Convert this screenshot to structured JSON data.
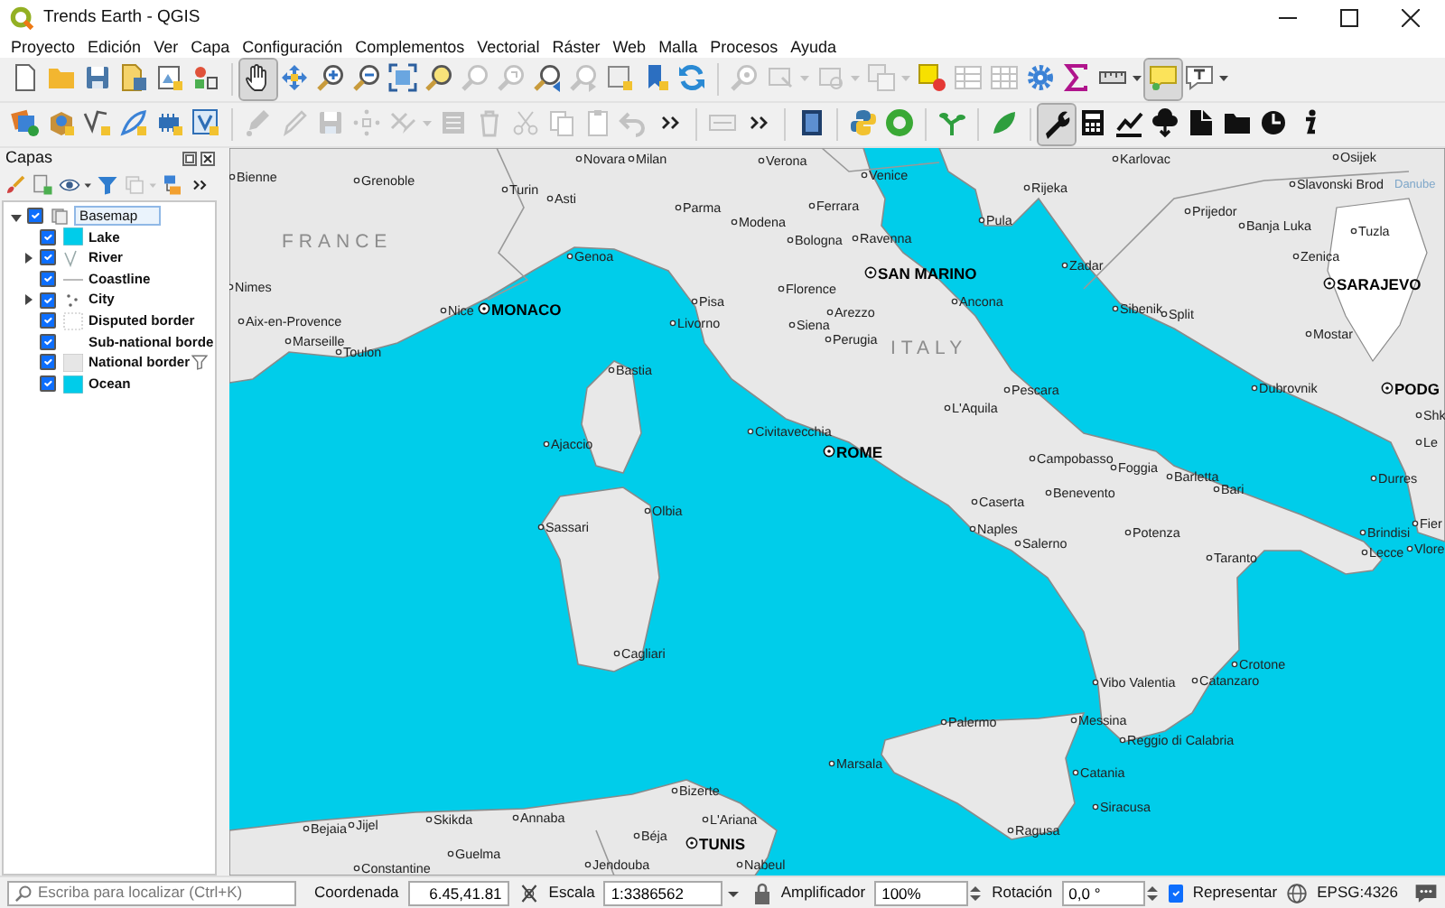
{
  "window": {
    "title": "Trends Earth - QGIS"
  },
  "menu": [
    "Proyecto",
    "Edición",
    "Ver",
    "Capa",
    "Configuración",
    "Complementos",
    "Vectorial",
    "Ráster",
    "Web",
    "Malla",
    "Procesos",
    "Ayuda"
  ],
  "toolbars": [
    {
      "groups": [
        {
          "items": [
            {
              "kind": "new",
              "disabled": false,
              "selected": false
            },
            {
              "kind": "open",
              "disabled": false,
              "selected": false
            },
            {
              "kind": "save",
              "disabled": false,
              "selected": false
            },
            {
              "kind": "saveas",
              "disabled": false,
              "selected": false
            },
            {
              "kind": "layout",
              "disabled": false,
              "selected": false
            },
            {
              "kind": "style",
              "disabled": false,
              "selected": false
            }
          ]
        },
        {
          "items": [
            {
              "kind": "pan",
              "disabled": false,
              "selected": true
            },
            {
              "kind": "pansel",
              "disabled": false,
              "selected": false
            },
            {
              "kind": "zoomin",
              "disabled": false,
              "selected": false
            },
            {
              "kind": "zoomout",
              "disabled": false,
              "selected": false
            },
            {
              "kind": "zoomfull",
              "disabled": false,
              "selected": false
            },
            {
              "kind": "zoomsel",
              "disabled": false,
              "selected": false
            },
            {
              "kind": "zoomlayer",
              "disabled": true,
              "selected": false
            },
            {
              "kind": "zoomnative",
              "disabled": true,
              "selected": false
            },
            {
              "kind": "zoomlast",
              "disabled": false,
              "selected": false
            },
            {
              "kind": "zoomnext",
              "disabled": true,
              "selected": false
            },
            {
              "kind": "mapview",
              "disabled": false,
              "selected": false
            },
            {
              "kind": "bookmark",
              "disabled": false,
              "selected": false
            },
            {
              "kind": "refresh",
              "disabled": false,
              "selected": false
            }
          ]
        },
        {
          "items": [
            {
              "kind": "identify",
              "disabled": true,
              "selected": false
            },
            {
              "kind": "select",
              "disabled": true,
              "selected": false,
              "dropdown": true
            },
            {
              "kind": "selval",
              "disabled": true,
              "selected": false,
              "dropdown": true
            },
            {
              "kind": "deselect",
              "disabled": true,
              "selected": false,
              "dropdown": true
            },
            {
              "kind": "attrsel",
              "disabled": false,
              "selected": false
            },
            {
              "kind": "table",
              "disabled": true,
              "selected": false
            },
            {
              "kind": "fieldcalc",
              "disabled": true,
              "selected": false
            },
            {
              "kind": "gear",
              "disabled": false,
              "selected": false
            },
            {
              "kind": "sigma",
              "disabled": false,
              "selected": false
            },
            {
              "kind": "ruler",
              "disabled": false,
              "selected": false,
              "dropdown": true
            },
            {
              "kind": "annot",
              "disabled": false,
              "selected": true
            },
            {
              "kind": "text",
              "disabled": false,
              "selected": false,
              "dropdown": true
            }
          ]
        }
      ]
    },
    {
      "groups": [
        {
          "items": [
            {
              "kind": "datasrc",
              "disabled": false,
              "selected": false
            },
            {
              "kind": "package",
              "disabled": false,
              "selected": false
            },
            {
              "kind": "vertex",
              "disabled": false,
              "selected": false
            },
            {
              "kind": "feather",
              "disabled": false,
              "selected": false
            },
            {
              "kind": "chip",
              "disabled": false,
              "selected": false
            },
            {
              "kind": "virtual",
              "disabled": false,
              "selected": false
            }
          ]
        },
        {
          "items": [
            {
              "kind": "editpencil",
              "disabled": true,
              "selected": false
            },
            {
              "kind": "pencil",
              "disabled": true,
              "selected": false
            },
            {
              "kind": "save",
              "disabled": true,
              "selected": false
            },
            {
              "kind": "nodes",
              "disabled": true,
              "selected": false
            },
            {
              "kind": "delsel",
              "disabled": true,
              "selected": false,
              "dropdown": true
            },
            {
              "kind": "attrtable",
              "disabled": true,
              "selected": false
            },
            {
              "kind": "trash",
              "disabled": true,
              "selected": false
            },
            {
              "kind": "scissors",
              "disabled": true,
              "selected": false
            },
            {
              "kind": "copy",
              "disabled": true,
              "selected": false
            },
            {
              "kind": "paste",
              "disabled": true,
              "selected": false
            },
            {
              "kind": "undo",
              "disabled": true,
              "selected": false
            },
            {
              "kind": "more",
              "disabled": false,
              "selected": false
            }
          ]
        },
        {
          "items": [
            {
              "kind": "label",
              "disabled": true,
              "selected": false
            },
            {
              "kind": "more",
              "disabled": false,
              "selected": false
            }
          ]
        },
        {
          "items": [
            {
              "kind": "help",
              "disabled": false,
              "selected": false
            }
          ]
        },
        {
          "items": [
            {
              "kind": "python",
              "disabled": false,
              "selected": false
            },
            {
              "kind": "ring",
              "disabled": false,
              "selected": false
            }
          ]
        },
        {
          "items": [
            {
              "kind": "sprout",
              "disabled": false,
              "selected": false
            }
          ]
        },
        {
          "items": [
            {
              "kind": "leaf",
              "disabled": false,
              "selected": false
            }
          ]
        },
        {
          "items": [
            {
              "kind": "wrench",
              "disabled": false,
              "selected": true
            },
            {
              "kind": "calc",
              "disabled": false,
              "selected": false
            },
            {
              "kind": "chart",
              "disabled": false,
              "selected": false
            },
            {
              "kind": "cloud",
              "disabled": false,
              "selected": false
            },
            {
              "kind": "doc",
              "disabled": false,
              "selected": false
            },
            {
              "kind": "folderb",
              "disabled": false,
              "selected": false
            },
            {
              "kind": "clock",
              "disabled": false,
              "selected": false
            },
            {
              "kind": "info",
              "disabled": false,
              "selected": false
            }
          ]
        }
      ]
    }
  ],
  "layers_panel": {
    "title": "Capas",
    "toolbar": [
      {
        "kind": "brush",
        "disabled": false
      },
      {
        "kind": "addgroup",
        "disabled": false
      },
      {
        "kind": "eye",
        "disabled": false,
        "dropdown": true
      },
      {
        "kind": "filter",
        "disabled": false
      },
      {
        "kind": "filterexp",
        "disabled": true,
        "dropdown": true
      },
      {
        "kind": "expand",
        "disabled": false
      },
      {
        "kind": "more",
        "disabled": false
      }
    ],
    "tree": [
      {
        "name": "Basemap",
        "checked": true,
        "expanded": true,
        "selected": true,
        "children": [
          {
            "name": "Lake",
            "checked": true,
            "selected": false,
            "kind": "fill",
            "color": "#00ccea",
            "filtered": false
          },
          {
            "name": "River",
            "checked": true,
            "expanded": false,
            "selected": false,
            "kind": "river",
            "filtered": false
          },
          {
            "name": "Coastline",
            "checked": true,
            "selected": false,
            "kind": "line",
            "filtered": false
          },
          {
            "name": "City",
            "checked": true,
            "expanded": false,
            "selected": false,
            "kind": "points",
            "filtered": false
          },
          {
            "name": "Disputed border",
            "checked": true,
            "selected": false,
            "kind": "outline",
            "filtered": false
          },
          {
            "name": "Sub-national borde",
            "checked": true,
            "selected": false,
            "kind": "blank",
            "filtered": false
          },
          {
            "name": "National border",
            "checked": true,
            "selected": false,
            "kind": "fill",
            "color": "#e6e6e6",
            "filtered": true
          },
          {
            "name": "Ocean",
            "checked": true,
            "selected": false,
            "kind": "fill",
            "color": "#00ccea",
            "filtered": false
          }
        ]
      }
    ]
  },
  "map": {
    "places": [
      {
        "name": "Novara",
        "kind": "city"
      },
      {
        "name": "Milan",
        "kind": "city"
      },
      {
        "name": "Verona",
        "kind": "city"
      },
      {
        "name": "Karlovac",
        "kind": "city"
      },
      {
        "name": "Osijek",
        "kind": "city"
      },
      {
        "name": "Bienne",
        "kind": "city"
      },
      {
        "name": "Grenoble",
        "kind": "city"
      },
      {
        "name": "Venice",
        "kind": "city"
      },
      {
        "name": "Turin",
        "kind": "city"
      },
      {
        "name": "Rijeka",
        "kind": "city"
      },
      {
        "name": "Slavonski Brod",
        "kind": "city"
      },
      {
        "name": "Danube",
        "kind": "river"
      },
      {
        "name": "Asti",
        "kind": "city"
      },
      {
        "name": "Parma",
        "kind": "city"
      },
      {
        "name": "Ferrara",
        "kind": "city"
      },
      {
        "name": "Prijedor",
        "kind": "city"
      },
      {
        "name": "Modena",
        "kind": "city"
      },
      {
        "name": "Pula",
        "kind": "city"
      },
      {
        "name": "Banja Luka",
        "kind": "city"
      },
      {
        "name": "Tuzla",
        "kind": "city"
      },
      {
        "name": "FRANCE",
        "kind": "country"
      },
      {
        "name": "Bologna",
        "kind": "city"
      },
      {
        "name": "Ravenna",
        "kind": "city"
      },
      {
        "name": "Genoa",
        "kind": "city"
      },
      {
        "name": "Zenica",
        "kind": "city"
      },
      {
        "name": "SAN MARINO",
        "kind": "capital"
      },
      {
        "name": "Zadar",
        "kind": "city"
      },
      {
        "name": "Nimes",
        "kind": "city"
      },
      {
        "name": "Florence",
        "kind": "city"
      },
      {
        "name": "SARAJEVO",
        "kind": "capital"
      },
      {
        "name": "Pisa",
        "kind": "city"
      },
      {
        "name": "Ancona",
        "kind": "city"
      },
      {
        "name": "Nice",
        "kind": "city"
      },
      {
        "name": "MONACO",
        "kind": "capital"
      },
      {
        "name": "Arezzo",
        "kind": "city"
      },
      {
        "name": "Sibenik",
        "kind": "city"
      },
      {
        "name": "Split",
        "kind": "city"
      },
      {
        "name": "Aix-en-Provence",
        "kind": "city"
      },
      {
        "name": "Livorno",
        "kind": "city"
      },
      {
        "name": "Siena",
        "kind": "city"
      },
      {
        "name": "Marseille",
        "kind": "city"
      },
      {
        "name": "Perugia",
        "kind": "city"
      },
      {
        "name": "Mostar",
        "kind": "city"
      },
      {
        "name": "Toulon",
        "kind": "city"
      },
      {
        "name": "ITALY",
        "kind": "country"
      },
      {
        "name": "Bastia",
        "kind": "city"
      },
      {
        "name": "Pescara",
        "kind": "city"
      },
      {
        "name": "Dubrovnik",
        "kind": "city"
      },
      {
        "name": "PODG",
        "kind": "capital"
      },
      {
        "name": "L'Aquila",
        "kind": "city"
      },
      {
        "name": "Shk",
        "kind": "city"
      },
      {
        "name": "Civitavecchia",
        "kind": "city"
      },
      {
        "name": "Ajaccio",
        "kind": "city"
      },
      {
        "name": "ROME",
        "kind": "capital"
      },
      {
        "name": "Le",
        "kind": "city"
      },
      {
        "name": "Campobasso",
        "kind": "city"
      },
      {
        "name": "Foggia",
        "kind": "city"
      },
      {
        "name": "Barletta",
        "kind": "city"
      },
      {
        "name": "Durres",
        "kind": "city"
      },
      {
        "name": "Benevento",
        "kind": "city"
      },
      {
        "name": "Bari",
        "kind": "city"
      },
      {
        "name": "Caserta",
        "kind": "city"
      },
      {
        "name": "Olbia",
        "kind": "city"
      },
      {
        "name": "Sassari",
        "kind": "city"
      },
      {
        "name": "Naples",
        "kind": "city"
      },
      {
        "name": "Potenza",
        "kind": "city"
      },
      {
        "name": "Brindisi",
        "kind": "city"
      },
      {
        "name": "Fier",
        "kind": "city"
      },
      {
        "name": "Salerno",
        "kind": "city"
      },
      {
        "name": "Taranto",
        "kind": "city"
      },
      {
        "name": "Lecce",
        "kind": "city"
      },
      {
        "name": "Vlore",
        "kind": "city"
      },
      {
        "name": "Cagliari",
        "kind": "city"
      },
      {
        "name": "Crotone",
        "kind": "city"
      },
      {
        "name": "Vibo Valentia",
        "kind": "city"
      },
      {
        "name": "Catanzaro",
        "kind": "city"
      },
      {
        "name": "Palermo",
        "kind": "city"
      },
      {
        "name": "Messina",
        "kind": "city"
      },
      {
        "name": "Reggio di Calabria",
        "kind": "city"
      },
      {
        "name": "Marsala",
        "kind": "city"
      },
      {
        "name": "Catania",
        "kind": "city"
      },
      {
        "name": "Bizerte",
        "kind": "city"
      },
      {
        "name": "Siracusa",
        "kind": "city"
      },
      {
        "name": "Bejaia",
        "kind": "city"
      },
      {
        "name": "Jijel",
        "kind": "city"
      },
      {
        "name": "Skikda",
        "kind": "city"
      },
      {
        "name": "Annaba",
        "kind": "city"
      },
      {
        "name": "Béja",
        "kind": "city"
      },
      {
        "name": "L'Ariana",
        "kind": "city"
      },
      {
        "name": "Ragusa",
        "kind": "city"
      },
      {
        "name": "TUNIS",
        "kind": "capital"
      },
      {
        "name": "Guelma",
        "kind": "city"
      },
      {
        "name": "Constantine",
        "kind": "city"
      },
      {
        "name": "Jendouba",
        "kind": "city"
      },
      {
        "name": "Nabeul",
        "kind": "city"
      }
    ]
  },
  "status_bar": {
    "search_placeholder": "Escriba para localizar (Ctrl+K)",
    "coordinate_label": "Coordenada",
    "coordinate": "6.45,41.81",
    "scale_label": "Escala",
    "scale": "1:3386562",
    "magnifier_label": "Amplificador",
    "magnifier": "100%",
    "rotation_label": "Rotación",
    "rotation": "0,0 °",
    "render_label": "Representar",
    "render_checked": true,
    "crs": "EPSG:4326"
  }
}
